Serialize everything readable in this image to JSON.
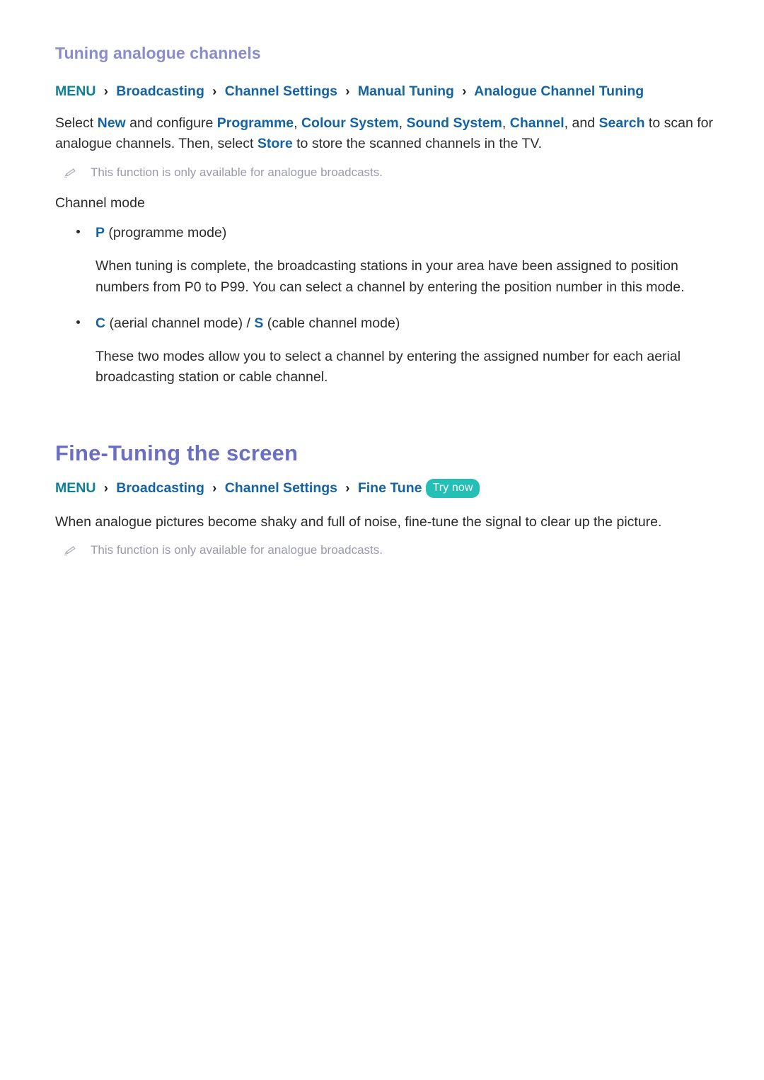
{
  "section1": {
    "heading": "Tuning analogue channels",
    "breadcrumb": {
      "menu": "MENU",
      "separator": "›",
      "items": [
        "Broadcasting",
        "Channel Settings",
        "Manual Tuning",
        "Analogue Channel Tuning"
      ]
    },
    "paragraph": {
      "t1": "Select ",
      "k1": "New",
      "t2": " and configure ",
      "k2": "Programme",
      "t3": ", ",
      "k3": "Colour System",
      "t4": ", ",
      "k4": "Sound System",
      "t5": ", ",
      "k5": "Channel",
      "t6": ", and ",
      "k6": "Search",
      "t7": " to scan for analogue channels. Then, select ",
      "k7": "Store",
      "t8": " to store the scanned channels in the TV."
    },
    "note": "This function is only available for analogue broadcasts.",
    "channel_mode_label": "Channel mode",
    "bullets": [
      {
        "key": "P",
        "rest": " (programme mode)",
        "detail": "When tuning is complete, the broadcasting stations in your area have been assigned to position numbers from P0 to P99. You can select a channel by entering the position number in this mode."
      },
      {
        "key": "C",
        "rest": " (aerial channel mode) / ",
        "key2": "S",
        "rest2": " (cable channel mode)",
        "detail": "These two modes allow you to select a channel by entering the assigned number for each aerial broadcasting station or cable channel."
      }
    ]
  },
  "section2": {
    "heading": "Fine-Tuning the screen",
    "breadcrumb": {
      "menu": "MENU",
      "separator": "›",
      "items": [
        "Broadcasting",
        "Channel Settings",
        "Fine Tune"
      ],
      "badge": "Try now"
    },
    "paragraph": "When analogue pictures become shaky and full of noise, fine-tune the signal to clear up the picture.",
    "note": "This function is only available for analogue broadcasts."
  },
  "colors": {
    "sub_heading": "#8a8ccb",
    "main_heading": "#6a6fc4",
    "menu_teal": "#0d7f96",
    "link_blue": "#1464a5",
    "badge_teal": "#24bfb5",
    "body": "#2b2b2b",
    "note": "#9a9aad"
  }
}
